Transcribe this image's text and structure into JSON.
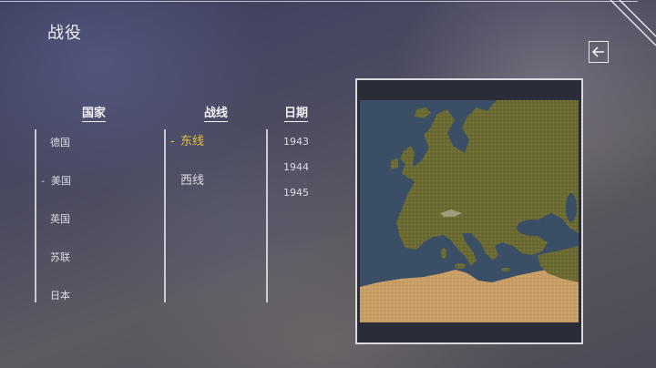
{
  "screen": {
    "title": "战役",
    "back_icon": "arrow-left-icon"
  },
  "columns": {
    "country": {
      "header": "国家",
      "items": [
        {
          "label": "德国",
          "selected": false
        },
        {
          "label": "美国",
          "selected": true
        },
        {
          "label": "英国",
          "selected": false
        },
        {
          "label": "苏联",
          "selected": false
        },
        {
          "label": "日本",
          "selected": false
        }
      ]
    },
    "front": {
      "header": "战线",
      "items": [
        {
          "label": "东线",
          "selected": true
        },
        {
          "label": "西线",
          "selected": false
        }
      ]
    },
    "date": {
      "header": "日期",
      "items": [
        {
          "label": "1943",
          "selected": false
        },
        {
          "label": "1944",
          "selected": false
        },
        {
          "label": "1945",
          "selected": false
        }
      ]
    }
  },
  "selection_marker": "-",
  "colors": {
    "selected": "#e8c23a",
    "text": "#dcdce4",
    "sea": "#3a4f66",
    "land": "#6e6d34",
    "desert": "#c9a168"
  }
}
